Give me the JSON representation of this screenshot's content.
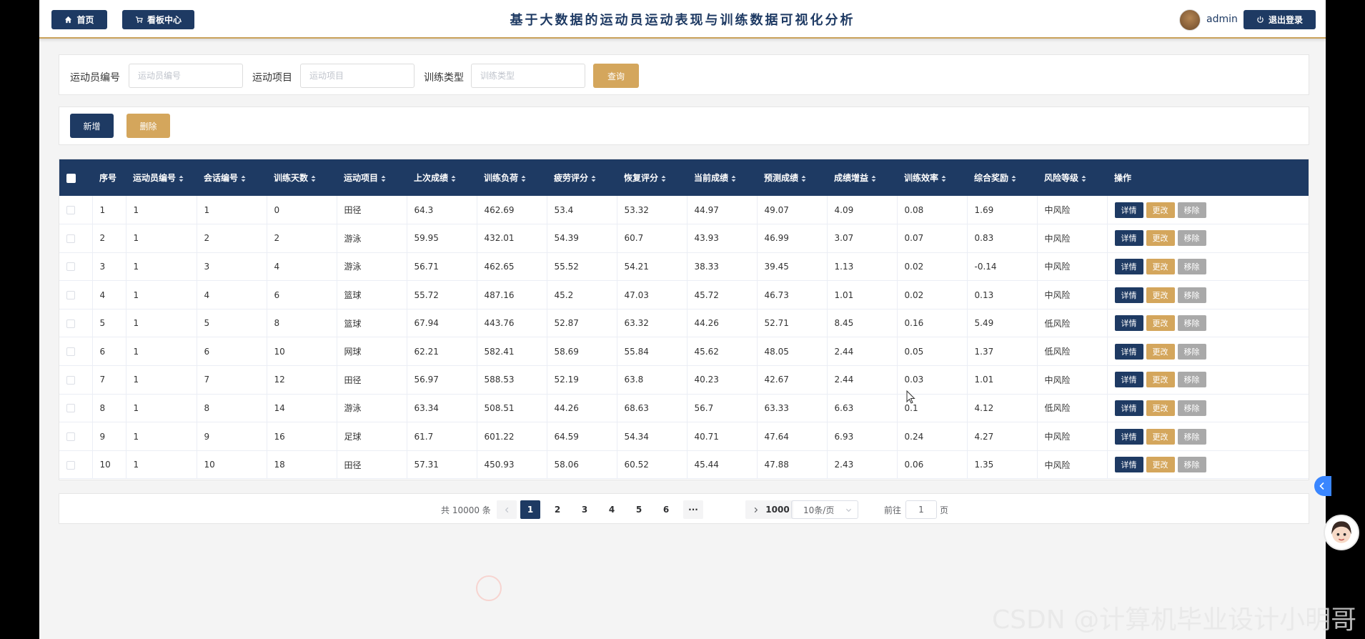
{
  "header": {
    "home_label": "首页",
    "dashboard_label": "看板中心",
    "title": "基于大数据的运动员运动表现与训练数据可视化分析",
    "username": "admin",
    "logout_label": "退出登录"
  },
  "search": {
    "athlete_id_label": "运动员编号",
    "athlete_id_placeholder": "运动员编号",
    "sport_label": "运动项目",
    "sport_placeholder": "运动项目",
    "training_type_label": "训练类型",
    "training_type_placeholder": "训练类型",
    "query_label": "查询"
  },
  "actions": {
    "add_label": "新增",
    "delete_label": "删除"
  },
  "table": {
    "columns": [
      "序号",
      "运动员编号",
      "会话编号",
      "训练天数",
      "运动项目",
      "上次成绩",
      "训练负荷",
      "疲劳评分",
      "恢复评分",
      "当前成绩",
      "预测成绩",
      "成绩增益",
      "训练效率",
      "综合奖励",
      "风险等级",
      "操作"
    ],
    "rows": [
      [
        "1",
        "1",
        "1",
        "0",
        "田径",
        "64.3",
        "462.69",
        "53.4",
        "53.32",
        "44.97",
        "49.07",
        "4.09",
        "0.08",
        "1.69",
        "中风险"
      ],
      [
        "2",
        "1",
        "2",
        "2",
        "游泳",
        "59.95",
        "432.01",
        "54.39",
        "60.7",
        "43.93",
        "46.99",
        "3.07",
        "0.07",
        "0.83",
        "中风险"
      ],
      [
        "3",
        "1",
        "3",
        "4",
        "游泳",
        "56.71",
        "462.65",
        "55.52",
        "54.21",
        "38.33",
        "39.45",
        "1.13",
        "0.02",
        "-0.14",
        "中风险"
      ],
      [
        "4",
        "1",
        "4",
        "6",
        "篮球",
        "55.72",
        "487.16",
        "45.2",
        "47.03",
        "45.72",
        "46.73",
        "1.01",
        "0.02",
        "0.13",
        "中风险"
      ],
      [
        "5",
        "1",
        "5",
        "8",
        "篮球",
        "67.94",
        "443.76",
        "52.87",
        "63.32",
        "44.26",
        "52.71",
        "8.45",
        "0.16",
        "5.49",
        "低风险"
      ],
      [
        "6",
        "1",
        "6",
        "10",
        "网球",
        "62.21",
        "582.41",
        "58.69",
        "55.84",
        "45.62",
        "48.05",
        "2.44",
        "0.05",
        "1.37",
        "低风险"
      ],
      [
        "7",
        "1",
        "7",
        "12",
        "田径",
        "56.97",
        "588.53",
        "52.19",
        "63.8",
        "40.23",
        "42.67",
        "2.44",
        "0.03",
        "1.01",
        "中风险"
      ],
      [
        "8",
        "1",
        "8",
        "14",
        "游泳",
        "63.34",
        "508.51",
        "44.26",
        "68.63",
        "56.7",
        "63.33",
        "6.63",
        "0.1",
        "4.12",
        "低风险"
      ],
      [
        "9",
        "1",
        "9",
        "16",
        "足球",
        "61.7",
        "601.22",
        "64.59",
        "54.34",
        "40.71",
        "47.64",
        "6.93",
        "0.24",
        "4.27",
        "中风险"
      ],
      [
        "10",
        "1",
        "10",
        "18",
        "田径",
        "57.31",
        "450.93",
        "58.06",
        "60.52",
        "45.44",
        "47.88",
        "2.43",
        "0.06",
        "1.35",
        "中风险"
      ]
    ],
    "detail_label": "详情",
    "edit_label": "更改",
    "remove_label": "移除"
  },
  "pagination": {
    "total_text": "共 10000 条",
    "pages": [
      "1",
      "2",
      "3",
      "4",
      "5",
      "6"
    ],
    "ellipsis": "···",
    "last_page": "1000",
    "page_size": "10条/页",
    "goto_prefix": "前往",
    "goto_value": "1",
    "goto_suffix": "页",
    "current_page": 1
  },
  "watermark": "CSDN @计算机毕业设计小明哥",
  "colors": {
    "navy": "#1e3a63",
    "gold": "#d4a65c",
    "gray_button": "#a9a9a9",
    "accent_blue": "#3a86ff"
  },
  "icons": [
    "home-icon",
    "cart-icon",
    "power-icon",
    "sort-icon",
    "chevron-left-icon",
    "chevron-right-icon",
    "chevron-down-icon",
    "collapse-icon"
  ]
}
